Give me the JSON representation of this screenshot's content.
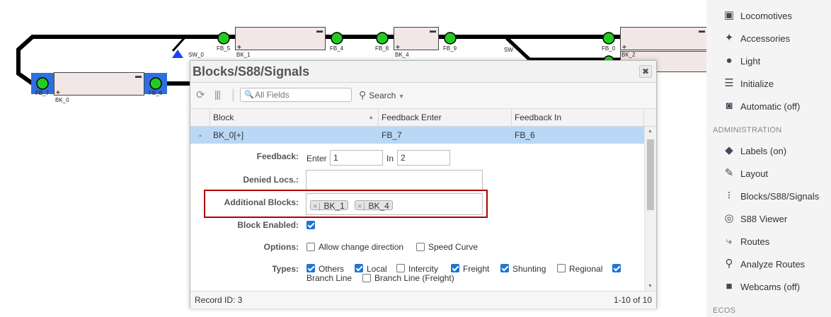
{
  "layout": {
    "labels": {
      "sw0": "SW_0",
      "sw_right": "SW",
      "fb5": "FB_5",
      "fb4": "FB_4",
      "fb8": "FB_8",
      "fb9": "FB_9",
      "fb0": "FB_0",
      "fb7": "FB_7",
      "fb6": "FB_6",
      "bk1": "BK_1",
      "bk4": "BK_4",
      "bk2": "BK_2",
      "bk0": "BK_0"
    }
  },
  "dialog": {
    "title": "Blocks/S88/Signals",
    "close_label": "✖",
    "search_placeholder": "All Fields",
    "search_button": "Search",
    "columns": [
      "Block",
      "Feedback Enter",
      "Feedback In"
    ],
    "row": {
      "toggle": "-",
      "block": "BK_0[+]",
      "feedback_enter": "FB_7",
      "feedback_in": "FB_6"
    },
    "form": {
      "feedback_label": "Feedback:",
      "enter_label": "Enter",
      "enter_value": "1",
      "in_label": "In",
      "in_value": "2",
      "denied_label": "Denied Locs.:",
      "additional_label": "Additional Blocks:",
      "additional_tags": [
        "BK_1",
        "BK_4"
      ],
      "tag_remove": "×",
      "enabled_label": "Block Enabled:",
      "enabled": true,
      "options_label": "Options:",
      "opt_change_direction": "Allow change direction",
      "opt_change_direction_checked": false,
      "opt_speed_curve": "Speed Curve",
      "opt_speed_curve_checked": false,
      "types_label": "Types:",
      "types": [
        {
          "label": "Others",
          "checked": true
        },
        {
          "label": "Local",
          "checked": true
        },
        {
          "label": "Intercity",
          "checked": false
        },
        {
          "label": "Freight",
          "checked": true
        },
        {
          "label": "Shunting",
          "checked": true
        },
        {
          "label": "Regional",
          "checked": false
        },
        {
          "label": "Branch Line",
          "checked": true
        },
        {
          "label": "Branch Line (Freight)",
          "checked": false
        }
      ]
    },
    "footer": {
      "record": "Record ID: 3",
      "range": "1-10 of 10"
    }
  },
  "sidebar": {
    "items_top": [
      {
        "label": "Locomotives",
        "icon": "locomotive-icon"
      },
      {
        "label": "Accessories",
        "icon": "wand-icon"
      },
      {
        "label": "Light",
        "icon": "lightbulb-icon"
      },
      {
        "label": "Initialize",
        "icon": "list-check-icon"
      },
      {
        "label": "Automatic (off)",
        "icon": "robot-icon"
      }
    ],
    "section_admin": "ADMINISTRATION",
    "items_admin": [
      {
        "label": "Labels (on)",
        "icon": "tag-icon"
      },
      {
        "label": "Layout",
        "icon": "edit-icon"
      },
      {
        "label": "Blocks/S88/Signals",
        "icon": "traffic-light-icon"
      },
      {
        "label": "S88 Viewer",
        "icon": "sensor-icon"
      },
      {
        "label": "Routes",
        "icon": "route-icon"
      },
      {
        "label": "Analyze Routes",
        "icon": "analyze-icon"
      },
      {
        "label": "Webcams (off)",
        "icon": "camera-icon"
      }
    ],
    "section_ecos": "ECOS"
  },
  "colors": {
    "track": "#000000",
    "sensor": "#22cc22",
    "block_fill": "#f3e6e6",
    "selected_block": "#2f6fe0",
    "row_selected": "#b9d8f6",
    "highlight": "#b00000",
    "checkbox": "#1e75d6"
  }
}
